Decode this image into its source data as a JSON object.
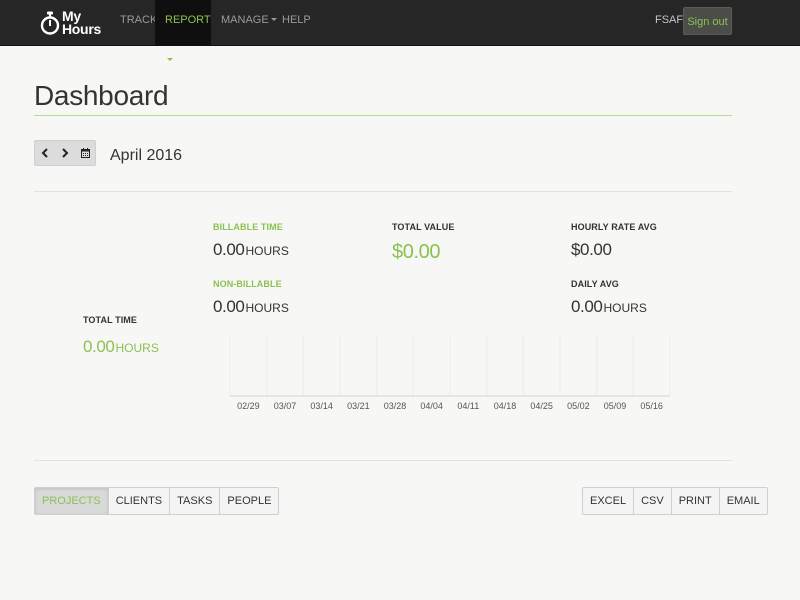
{
  "navbar": {
    "logo": {
      "line1": "My",
      "line2": "Hours"
    },
    "items": [
      {
        "label": "TRACK",
        "active": false,
        "dropdown": false
      },
      {
        "label": "REPORT",
        "active": true,
        "dropdown": true
      },
      {
        "label": "MANAGE",
        "active": false,
        "dropdown": true
      },
      {
        "label": "HELP",
        "active": false,
        "dropdown": false
      }
    ],
    "user": "FSAF",
    "signout_label": "Sign out"
  },
  "page": {
    "title": "Dashboard",
    "month": "April 2016",
    "controls": {
      "prev_icon": "chevron-left-icon",
      "next_icon": "chevron-right-icon",
      "calendar_icon": "calendar-icon"
    }
  },
  "stats": {
    "total_time": {
      "label": "TOTAL TIME",
      "value": "0.00",
      "unit": "HOURS"
    },
    "billable_time": {
      "label": "BILLABLE TIME",
      "value": "0.00",
      "unit": "HOURS"
    },
    "non_billable": {
      "label": "NON-BILLABLE",
      "value": "0.00",
      "unit": "HOURS"
    },
    "total_value": {
      "label": "TOTAL VALUE",
      "value": "$0.00"
    },
    "hourly_rate_avg": {
      "label": "HOURLY RATE AVG",
      "value": "$0.00"
    },
    "daily_avg": {
      "label": "DAILY AVG",
      "value": "0.00",
      "unit": "HOURS"
    }
  },
  "chart_data": {
    "type": "bar",
    "categories": [
      "02/29",
      "03/07",
      "03/14",
      "03/21",
      "03/28",
      "04/04",
      "04/11",
      "04/18",
      "04/25",
      "05/02",
      "05/09",
      "05/16"
    ],
    "values": [
      0,
      0,
      0,
      0,
      0,
      0,
      0,
      0,
      0,
      0,
      0,
      0
    ],
    "title": "",
    "xlabel": "",
    "ylabel": "",
    "grid": true
  },
  "tabs": [
    "PROJECTS",
    "CLIENTS",
    "TASKS",
    "PEOPLE"
  ],
  "active_tab": 0,
  "exports": [
    "EXCEL",
    "CSV",
    "PRINT",
    "EMAIL"
  ],
  "colors": {
    "accent": "#8cc152",
    "navbar": "#262626",
    "navbar_active": "#0f0f0f",
    "background": "#f7f7f5"
  }
}
